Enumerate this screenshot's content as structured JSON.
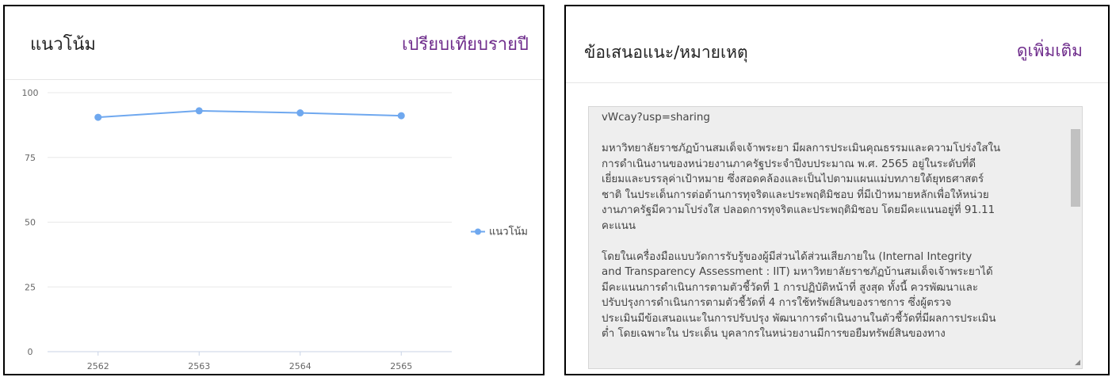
{
  "trend_card": {
    "title": "แนวโน้ม",
    "compare_link": "เปรียบเทียบรายปี"
  },
  "notes_card": {
    "title": "ข้อเสนอแนะ/หมายเหตุ",
    "more_link": "ดูเพิ่มเติม",
    "text": "vWcay?usp=sharing\n\nมหาวิทยาลัยราชภัฏบ้านสมเด็จเจ้าพระยา มีผลการประเมินคุณธรรมและความโปร่งใสใน\nการดำเนินงานของหน่วยงานภาครัฐประจำปีงบประมาณ พ.ศ. 2565 อยู่ในระดับที่ดี\nเยี่ยมและบรรลุค่าเป้าหมาย ซึ่งสอดคล้องและเป็นไปตามแผนแม่บทภายใต้ยุทธศาสตร์\nชาติ ในประเด็นการต่อต้านการทุจริตและประพฤติมิชอบ ที่มีเป้าหมายหลักเพื่อให้หน่วย\nงานภาครัฐมีความโปร่งใส ปลอดการทุจริตและประพฤติมิชอบ โดยมีคะแนนอยู่ที่ 91.11\nคะแนน\n\nโดยในเครื่องมือแบบวัดการรับรู้ของผู้มีส่วนได้ส่วนเสียภายใน (Internal Integrity\nand Transparency Assessment : IIT) มหาวิทยาลัยราชภัฏบ้านสมเด็จเจ้าพระยาได้\nมีคะแนนการดำเนินการตามตัวชี้วัดที่ 1 การปฏิบัติหน้าที่ สูงสุด ทั้งนี้ ควรพัฒนาและ\nปรับปรุงการดำเนินการตามตัวชี้วัดที่ 4 การใช้ทรัพย์สินของราชการ ซึ่งผู้ตรวจ\nประเมินมีข้อเสนอแนะในการปรับปรุง พัฒนาการดำเนินงานในตัวชี้วัดที่มีผลการประเมิน\nต่ำ โดยเฉพาะใน ประเด็น บุคลากรในหน่วยงานมีการขอยืมทรัพย์สินของทาง"
  },
  "chart_data": {
    "type": "line",
    "categories": [
      "2562",
      "2563",
      "2564",
      "2565"
    ],
    "series": [
      {
        "name": "แนวโน้ม",
        "values": [
          90.5,
          93.0,
          92.2,
          91.11
        ]
      }
    ],
    "ylim": [
      0,
      100
    ],
    "yticks": [
      "0",
      "25",
      "50",
      "75",
      "100"
    ],
    "grid": true,
    "legend": "right",
    "color": "#6fa8ef"
  }
}
